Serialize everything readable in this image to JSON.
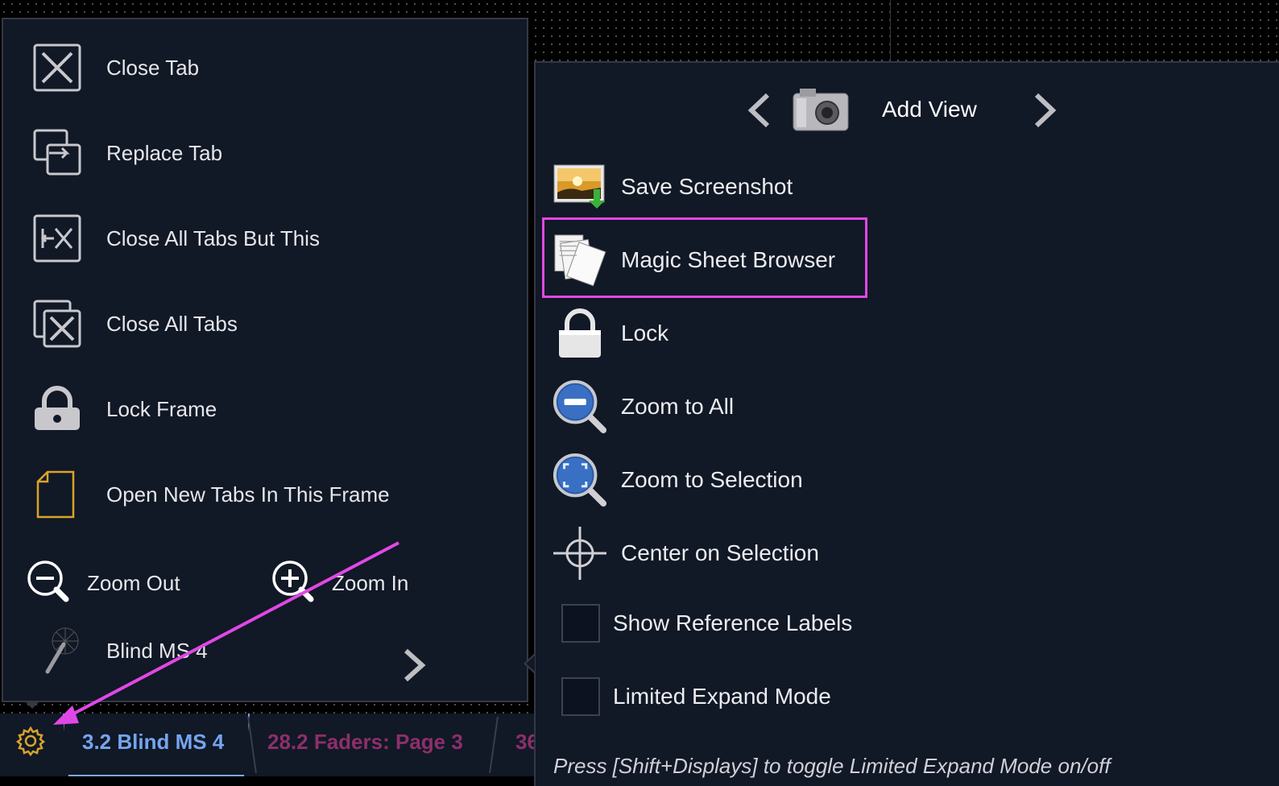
{
  "left_menu": {
    "items": [
      {
        "label": "Close Tab",
        "icon": "close-tab-icon"
      },
      {
        "label": "Replace Tab",
        "icon": "replace-tab-icon"
      },
      {
        "label": "Close All Tabs But This",
        "icon": "close-others-icon"
      },
      {
        "label": "Close All Tabs",
        "icon": "close-all-tabs-icon"
      },
      {
        "label": "Lock Frame",
        "icon": "lock-frame-icon"
      },
      {
        "label": "Open New Tabs In This Frame",
        "icon": "new-document-icon"
      }
    ],
    "zoom_out_label": "Zoom Out",
    "zoom_in_label": "Zoom In",
    "submenu_label": "Blind MS 4"
  },
  "tabs": {
    "active": "3.2 Blind MS 4",
    "second": "28.2 Faders: Page 3",
    "third": "36"
  },
  "right_menu": {
    "add_view_label": "Add View",
    "items": [
      {
        "label": "Save Screenshot",
        "icon": "save-screenshot-icon"
      },
      {
        "label": "Magic Sheet Browser",
        "icon": "pages-icon"
      },
      {
        "label": "Lock",
        "icon": "lock-icon"
      },
      {
        "label": "Zoom to All",
        "icon": "zoom-to-all-icon"
      },
      {
        "label": "Zoom to Selection",
        "icon": "zoom-to-selection-icon"
      },
      {
        "label": "Center on Selection",
        "icon": "crosshair-icon"
      }
    ],
    "checkboxes": [
      {
        "label": "Show Reference Labels",
        "checked": false
      },
      {
        "label": "Limited Expand Mode",
        "checked": false
      }
    ],
    "hint": "Press [Shift+Displays] to toggle Limited Expand Mode on/off"
  },
  "colors": {
    "highlight": "#e048e6",
    "active_tab": "#74a5f0",
    "inactive_tab": "#8c2f6a",
    "gear": "#d9a42a"
  }
}
